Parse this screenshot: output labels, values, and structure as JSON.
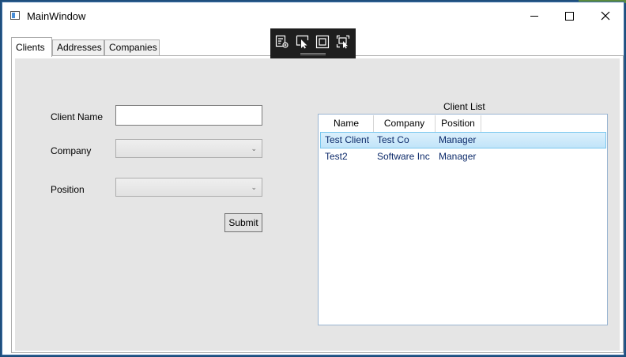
{
  "window": {
    "title": "MainWindow"
  },
  "tabs": [
    {
      "label": "Clients",
      "active": true
    },
    {
      "label": "Addresses",
      "active": false
    },
    {
      "label": "Companies",
      "active": false
    }
  ],
  "form": {
    "client_name_label": "Client Name",
    "client_name_value": "",
    "company_label": "Company",
    "company_value": "",
    "position_label": "Position",
    "position_value": "",
    "submit_label": "Submit"
  },
  "client_list": {
    "title": "Client List",
    "columns": [
      "Name",
      "Company",
      "Position"
    ],
    "rows": [
      {
        "name": "Test Client",
        "company": "Test Co",
        "position": "Manager",
        "selected": true
      },
      {
        "name": "Test2",
        "company": "Software Inc",
        "position": "Manager",
        "selected": false
      }
    ]
  },
  "debug_toolbar": {
    "icons": [
      "live-visual-tree-icon",
      "select-element-icon",
      "display-adorners-icon",
      "track-focus-icon"
    ]
  },
  "colors": {
    "panel_bg": "#e5e5e5",
    "selection_border": "#7ac7ef",
    "toolbar_bg": "#1e1e1e"
  }
}
